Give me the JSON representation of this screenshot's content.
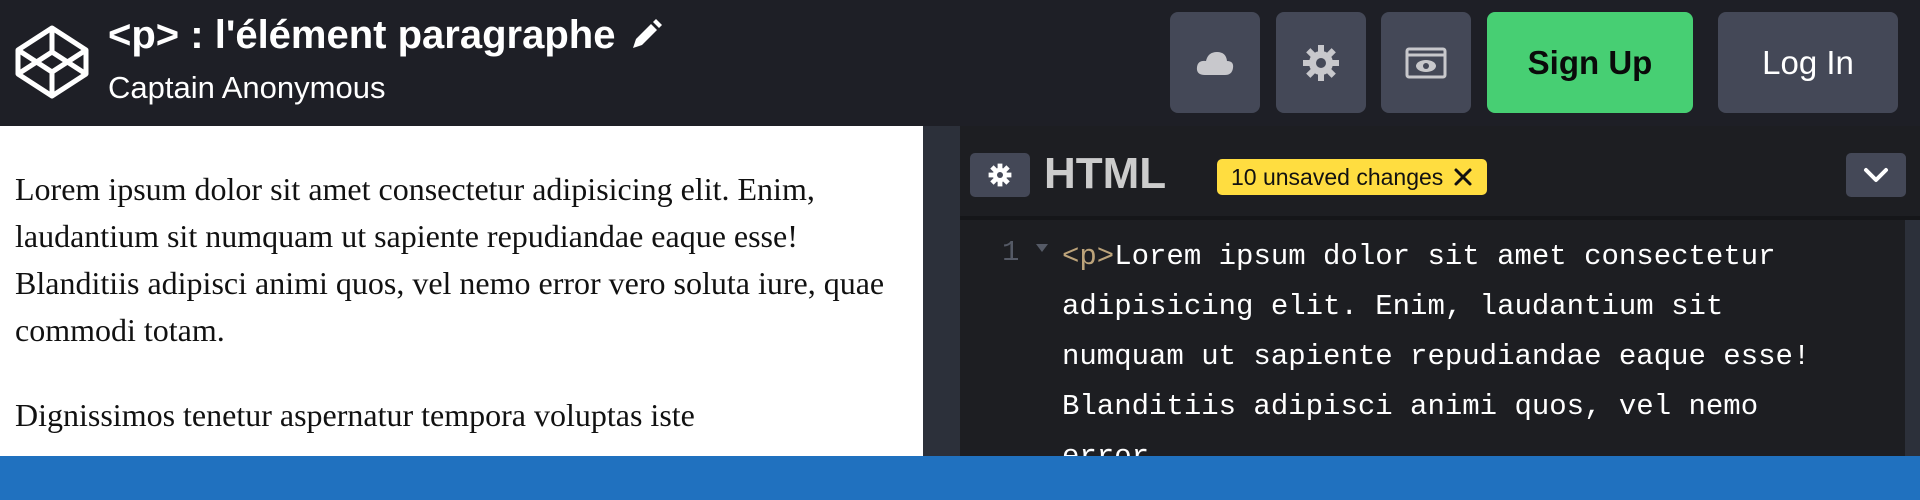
{
  "header": {
    "title": "<p> : l'élément paragraphe",
    "author": "Captain Anonymous",
    "buttons": {
      "cloud": "cloud-icon",
      "settings": "gear-icon",
      "view": "view-icon",
      "signup_label": "Sign Up",
      "login_label": "Log In"
    },
    "colors": {
      "signup": "#47cf73",
      "button": "#444857",
      "background": "#1e1f26"
    }
  },
  "preview": {
    "paragraphs": [
      "Lorem ipsum dolor sit amet consectetur adipisicing elit. Enim, laudantium sit numquam ut sapiente repudiandae eaque esse! Blanditiis adipisci animi quos, vel nemo error vero soluta iure, quae commodi totam.",
      "Dignissimos tenetur aspernatur tempora voluptas iste"
    ]
  },
  "editor": {
    "title": "HTML",
    "unsaved_badge": "10 unsaved changes",
    "line_number": "1",
    "code_tag": "<p>",
    "code_text": "Lorem ipsum dolor sit amet consectetur adipisicing elit. Enim, laudantium sit numquam ut sapiente repudiandae eaque esse! Blanditiis adipisci animi quos, vel nemo error",
    "colors": {
      "badge": "#ffdd40",
      "tag": "#bca37a"
    }
  },
  "footer": {
    "color": "#2071bf"
  }
}
